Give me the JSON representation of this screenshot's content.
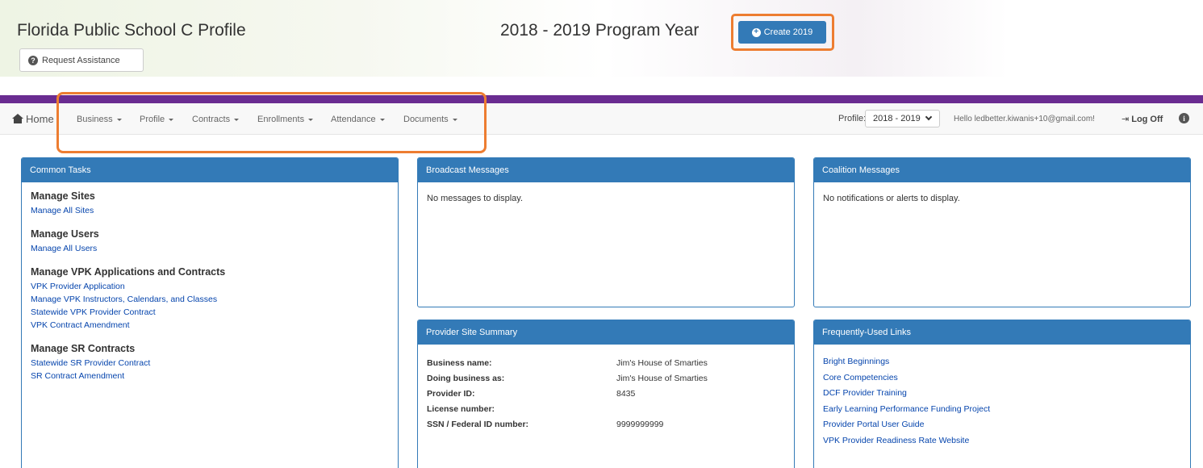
{
  "header": {
    "title": "Florida Public School C Profile",
    "program_year": "2018 - 2019 Program Year",
    "create_label": "Create 2019",
    "request_assistance": "Request Assistance"
  },
  "nav": {
    "home": "Home",
    "items": [
      {
        "label": "Business"
      },
      {
        "label": "Profile"
      },
      {
        "label": "Contracts"
      },
      {
        "label": "Enrollments"
      },
      {
        "label": "Attendance"
      },
      {
        "label": "Documents"
      }
    ],
    "profile_label": "Profile:",
    "profile_value": "2018 - 2019",
    "hello": "Hello ledbetter.kiwanis+10@gmail.com!",
    "logoff": "Log Off"
  },
  "common_tasks": {
    "title": "Common Tasks",
    "sections": [
      {
        "title": "Manage Sites",
        "links": [
          "Manage All Sites"
        ]
      },
      {
        "title": "Manage Users",
        "links": [
          "Manage All Users"
        ]
      },
      {
        "title": "Manage VPK Applications and Contracts",
        "links": [
          "VPK Provider Application",
          "Manage VPK Instructors, Calendars, and Classes",
          "Statewide VPK Provider Contract",
          "VPK Contract Amendment"
        ]
      },
      {
        "title": "Manage SR Contracts",
        "links": [
          "Statewide SR Provider Contract",
          "SR Contract Amendment"
        ]
      }
    ]
  },
  "broadcast": {
    "title": "Broadcast Messages",
    "message": "No messages to display."
  },
  "coalition": {
    "title": "Coalition Messages",
    "message": "No notifications or alerts to display."
  },
  "summary": {
    "title": "Provider Site Summary",
    "rows": [
      {
        "label": "Business name:",
        "value": "Jim's House of Smarties"
      },
      {
        "label": "Doing business as:",
        "value": "Jim's House of Smarties"
      },
      {
        "label": "Provider ID:",
        "value": "8435"
      },
      {
        "label": "License number:",
        "value": ""
      },
      {
        "label": "SSN / Federal ID number:",
        "value": "9999999999"
      }
    ]
  },
  "links": {
    "title": "Frequently-Used Links",
    "items": [
      "Bright Beginnings",
      "Core Competencies",
      "DCF Provider Training",
      "Early Learning Performance Funding Project",
      "Provider Portal User Guide",
      "VPK Provider Readiness Rate Website"
    ]
  },
  "colors": {
    "primary": "#337ab7",
    "accent": "#6a2c91",
    "highlight": "#ed7d31"
  }
}
